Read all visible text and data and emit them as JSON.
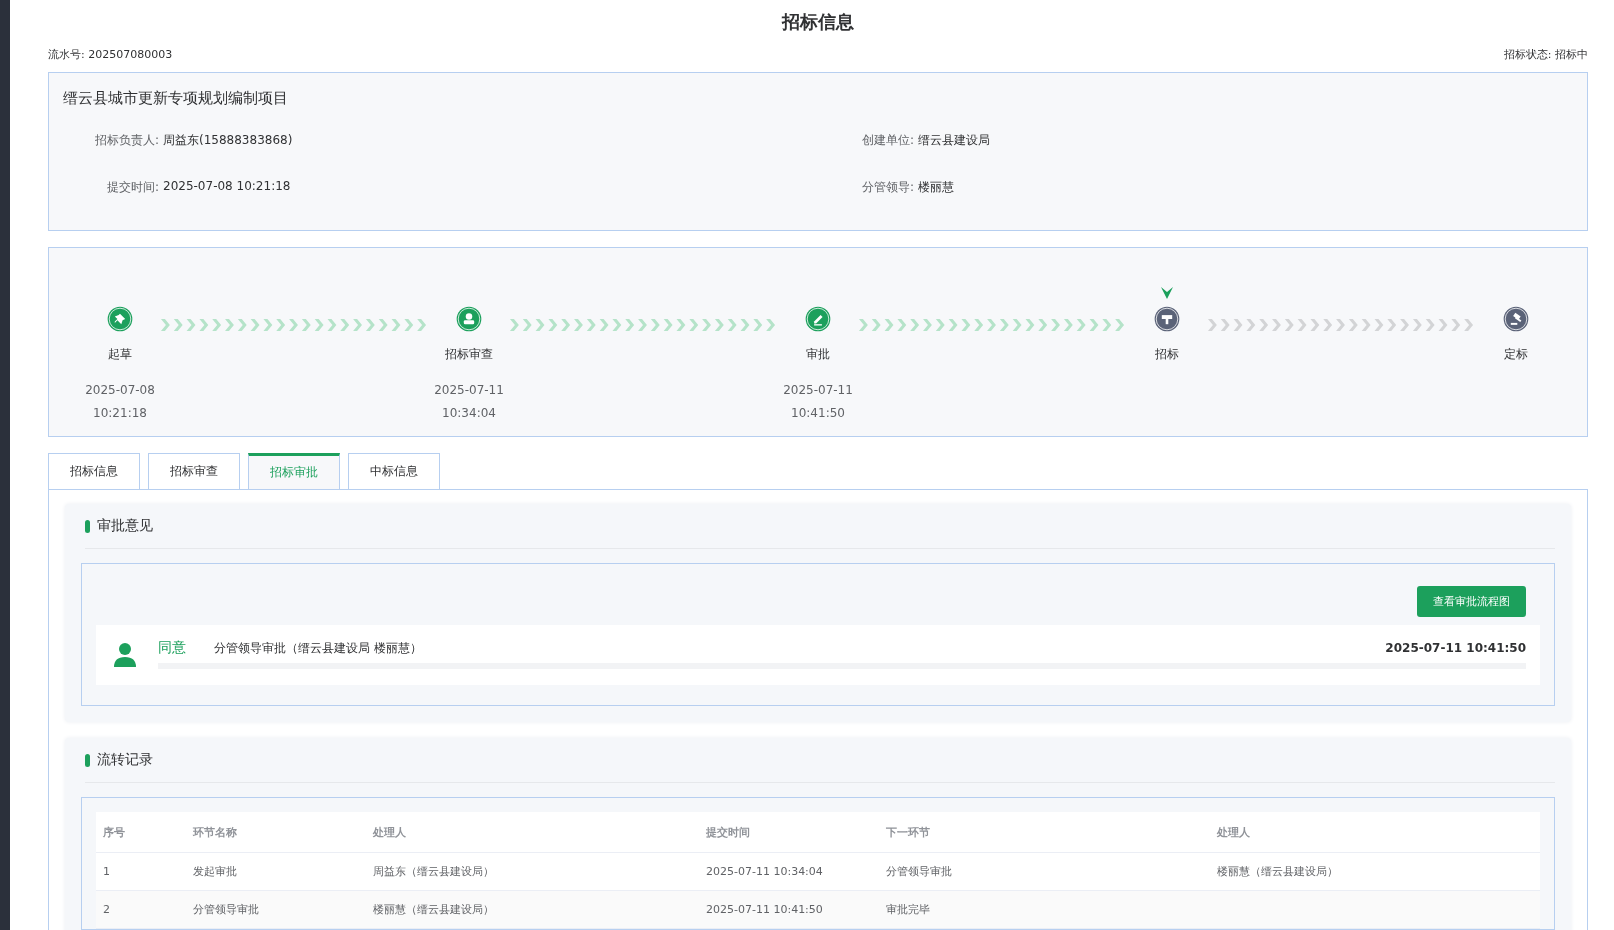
{
  "title": "招标信息",
  "serial": {
    "label": "流水号:",
    "value": "202507080003"
  },
  "status": {
    "label": "招标状态:",
    "value": "招标中"
  },
  "project": {
    "name": "缙云县城市更新专项规划编制项目",
    "fields": [
      {
        "label": "招标负责人:",
        "value": "周益东(15888383868)"
      },
      {
        "label": "创建单位:",
        "value": "缙云县建设局"
      },
      {
        "label": "提交时间:",
        "value": "2025-07-08 10:21:18"
      },
      {
        "label": "分管领导:",
        "value": "楼丽慧"
      }
    ]
  },
  "steps": [
    {
      "name": "起草",
      "done": true,
      "current": false,
      "date": "2025-07-08",
      "time": "10:21:18"
    },
    {
      "name": "招标审查",
      "done": true,
      "current": false,
      "date": "2025-07-11",
      "time": "10:34:04"
    },
    {
      "name": "审批",
      "done": true,
      "current": false,
      "date": "2025-07-11",
      "time": "10:41:50"
    },
    {
      "name": "招标",
      "done": false,
      "current": true
    },
    {
      "name": "定标",
      "done": false,
      "current": false
    }
  ],
  "tabs": [
    {
      "label": "招标信息",
      "selected": false
    },
    {
      "label": "招标审查",
      "selected": false
    },
    {
      "label": "招标审批",
      "selected": true
    },
    {
      "label": "中标信息",
      "selected": false
    }
  ],
  "opinion": {
    "title": "审批意见",
    "button": "查看审批流程图",
    "records": [
      {
        "result": "同意",
        "desc": "分管领导审批（缙云县建设局  楼丽慧）",
        "time": "2025-07-11 10:41:50"
      }
    ]
  },
  "history": {
    "title": "流转记录",
    "columns": [
      "序号",
      "环节名称",
      "处理人",
      "提交时间",
      "下一环节",
      "处理人"
    ],
    "rows": [
      [
        "1",
        "发起审批",
        "周益东（缙云县建设局）",
        "2025-07-11 10:34:04",
        "分管领导审批",
        "楼丽慧（缙云县建设局）"
      ],
      [
        "2",
        "分管领导审批",
        "楼丽慧（缙云县建设局）",
        "2025-07-11 10:41:50",
        "审批完毕"
      ]
    ]
  }
}
